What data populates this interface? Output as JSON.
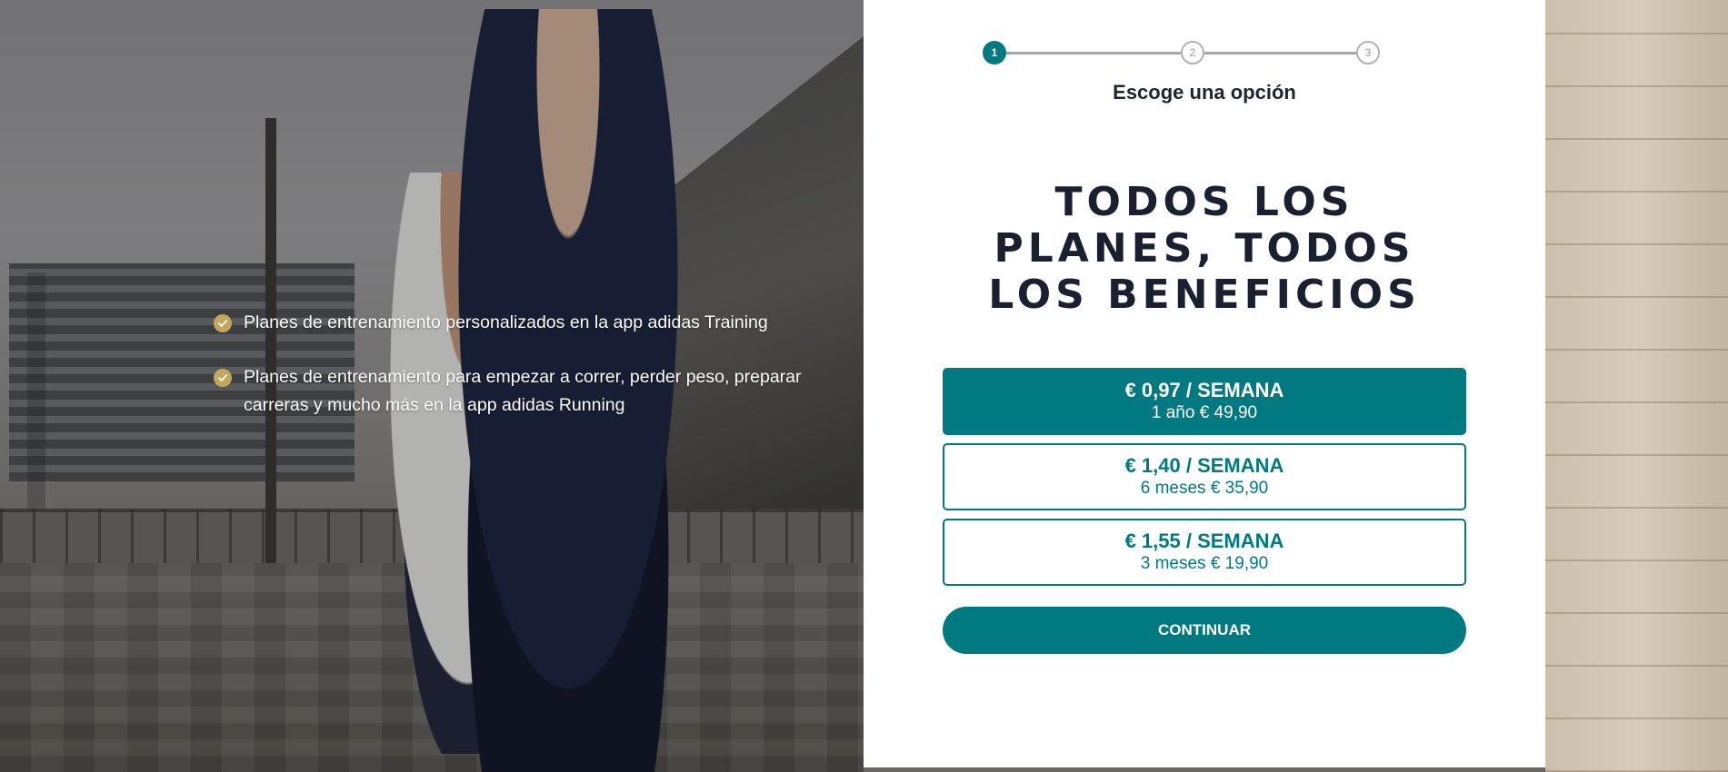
{
  "colors": {
    "accent": "#007a80",
    "check_badge": "#c3a85b",
    "headline_text": "#1a2030",
    "step_inactive": "#b2b2b2"
  },
  "benefits": [
    {
      "icon": "check-circle-icon",
      "text": "Planes de entrenamiento personalizados en la app adidas Training"
    },
    {
      "icon": "check-circle-icon",
      "text": "Planes de entrenamiento para empezar a correr, perder peso, preparar carreras y mucho más en la app adidas Running"
    }
  ],
  "stepper": {
    "current_step": 1,
    "steps": [
      {
        "label": "1",
        "state": "active"
      },
      {
        "label": "2",
        "state": "upcoming"
      },
      {
        "label": "3",
        "state": "upcoming"
      }
    ],
    "caption": "Escoge una opción"
  },
  "headline": "TODOS LOS PLANES, TODOS LOS BENEFICIOS",
  "plans": [
    {
      "price": "€ 0,97 / SEMANA",
      "detail": "1 año € 49,90",
      "selected": true
    },
    {
      "price": "€ 1,40 / SEMANA",
      "detail": "6 meses € 35,90",
      "selected": false
    },
    {
      "price": "€ 1,55 / SEMANA",
      "detail": "3 meses € 19,90",
      "selected": false
    }
  ],
  "continue_label": "CONTINUAR"
}
